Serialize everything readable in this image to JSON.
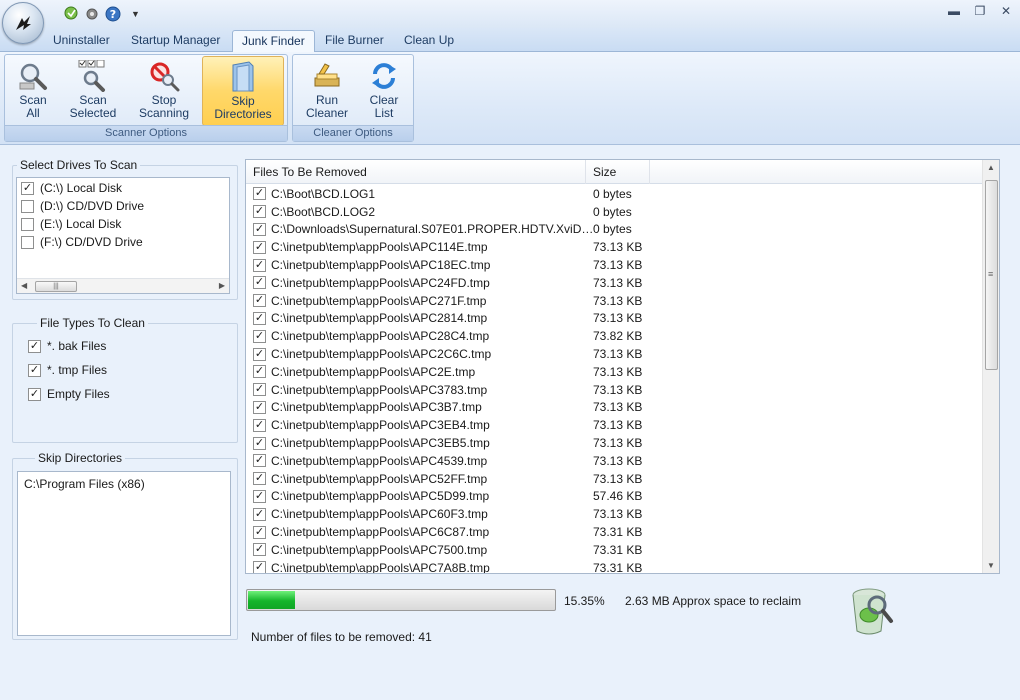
{
  "titlebar": {
    "quick_access": [
      {
        "icon": "broom-icon"
      },
      {
        "icon": "gear-icon"
      },
      {
        "icon": "help-icon"
      }
    ],
    "window_controls": [
      {
        "icon": "minimize-icon",
        "glyph": "▬"
      },
      {
        "icon": "restore-icon",
        "glyph": "❐"
      },
      {
        "icon": "close-icon",
        "glyph": "✕"
      }
    ]
  },
  "tabs": [
    {
      "label": "Uninstaller",
      "active": false
    },
    {
      "label": "Startup Manager",
      "active": false
    },
    {
      "label": "Junk Finder",
      "active": true
    },
    {
      "label": "File Burner",
      "active": false
    },
    {
      "label": "Clean Up",
      "active": false
    }
  ],
  "ribbon": {
    "scanner_group": {
      "label": "Scanner Options",
      "buttons": [
        {
          "line1": "Scan",
          "line2": "All",
          "icon": "magnifier-icon"
        },
        {
          "line1": "Scan",
          "line2": "Selected",
          "icon": "magnifier-checkbox-icon"
        },
        {
          "line1": "Stop",
          "line2": "Scanning",
          "icon": "stop-magnifier-icon"
        },
        {
          "line1": "Skip",
          "line2": "Directories",
          "icon": "folder-icon",
          "active": true
        }
      ]
    },
    "cleaner_group": {
      "label": "Cleaner Options",
      "buttons": [
        {
          "line1": "Run",
          "line2": "Cleaner",
          "icon": "cleaner-icon"
        },
        {
          "line1": "Clear",
          "line2": "List",
          "icon": "refresh-icon"
        }
      ]
    }
  },
  "drives": {
    "legend": "Select Drives To Scan",
    "items": [
      {
        "label": "(C:\\) Local Disk",
        "checked": true
      },
      {
        "label": "(D:\\) CD/DVD Drive",
        "checked": false
      },
      {
        "label": "(E:\\) Local Disk",
        "checked": false
      },
      {
        "label": "(F:\\) CD/DVD Drive",
        "checked": false
      }
    ]
  },
  "file_types": {
    "legend": "File Types To Clean",
    "items": [
      {
        "label": "*. bak Files",
        "checked": true
      },
      {
        "label": "*. tmp Files",
        "checked": true
      },
      {
        "label": "Empty Files",
        "checked": true
      }
    ]
  },
  "skip_directories": {
    "legend": "Skip Directories",
    "items": [
      "C:\\Program Files (x86)"
    ]
  },
  "file_list": {
    "columns": {
      "path": "Files To Be Removed",
      "size": "Size"
    },
    "rows": [
      {
        "path": "C:\\Boot\\BCD.LOG1",
        "size": "0 bytes"
      },
      {
        "path": "C:\\Boot\\BCD.LOG2",
        "size": "0 bytes"
      },
      {
        "path": "C:\\Downloads\\Supernatural.S07E01.PROPER.HDTV.XviD-2...",
        "size": "0 bytes"
      },
      {
        "path": "C:\\inetpub\\temp\\appPools\\APC114E.tmp",
        "size": "73.13 KB"
      },
      {
        "path": "C:\\inetpub\\temp\\appPools\\APC18EC.tmp",
        "size": "73.13 KB"
      },
      {
        "path": "C:\\inetpub\\temp\\appPools\\APC24FD.tmp",
        "size": "73.13 KB"
      },
      {
        "path": "C:\\inetpub\\temp\\appPools\\APC271F.tmp",
        "size": "73.13 KB"
      },
      {
        "path": "C:\\inetpub\\temp\\appPools\\APC2814.tmp",
        "size": "73.13 KB"
      },
      {
        "path": "C:\\inetpub\\temp\\appPools\\APC28C4.tmp",
        "size": "73.82 KB"
      },
      {
        "path": "C:\\inetpub\\temp\\appPools\\APC2C6C.tmp",
        "size": "73.13 KB"
      },
      {
        "path": "C:\\inetpub\\temp\\appPools\\APC2E.tmp",
        "size": "73.13 KB"
      },
      {
        "path": "C:\\inetpub\\temp\\appPools\\APC3783.tmp",
        "size": "73.13 KB"
      },
      {
        "path": "C:\\inetpub\\temp\\appPools\\APC3B7.tmp",
        "size": "73.13 KB"
      },
      {
        "path": "C:\\inetpub\\temp\\appPools\\APC3EB4.tmp",
        "size": "73.13 KB"
      },
      {
        "path": "C:\\inetpub\\temp\\appPools\\APC3EB5.tmp",
        "size": "73.13 KB"
      },
      {
        "path": "C:\\inetpub\\temp\\appPools\\APC4539.tmp",
        "size": "73.13 KB"
      },
      {
        "path": "C:\\inetpub\\temp\\appPools\\APC52FF.tmp",
        "size": "73.13 KB"
      },
      {
        "path": "C:\\inetpub\\temp\\appPools\\APC5D99.tmp",
        "size": "57.46 KB"
      },
      {
        "path": "C:\\inetpub\\temp\\appPools\\APC60F3.tmp",
        "size": "73.13 KB"
      },
      {
        "path": "C:\\inetpub\\temp\\appPools\\APC6C87.tmp",
        "size": "73.31 KB"
      },
      {
        "path": "C:\\inetpub\\temp\\appPools\\APC7500.tmp",
        "size": "73.31 KB"
      },
      {
        "path": "C:\\inetpub\\temp\\appPools\\APC7A8B.tmp",
        "size": "73.31 KB"
      }
    ]
  },
  "status": {
    "progress_fraction": 0.1535,
    "progress_text": "15.35%",
    "reclaim_text": "2.63 MB Approx space to reclaim",
    "count_text": "Number of files to be removed: 41"
  },
  "colors": {
    "accent": "#ffd86a",
    "progress": "#14b52b",
    "ribbon": "#dde9f8"
  }
}
